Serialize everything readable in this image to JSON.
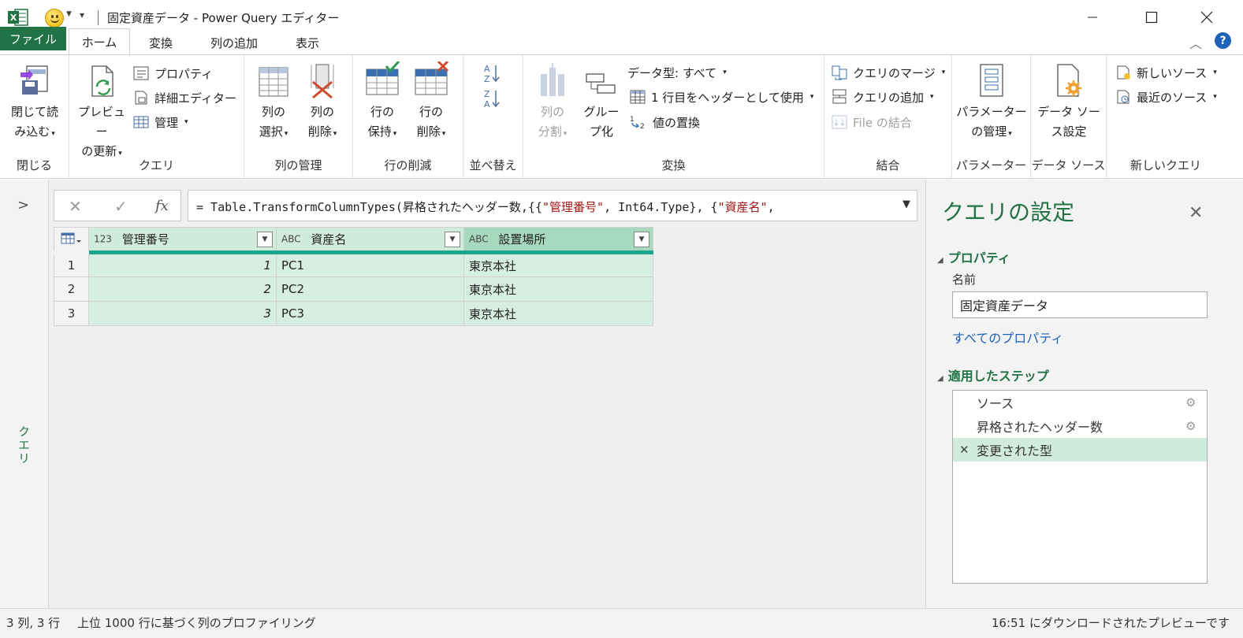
{
  "window": {
    "title": "固定資産データ - Power Query エディター"
  },
  "tabs": [
    "ファイル",
    "ホーム",
    "変換",
    "列の追加",
    "表示"
  ],
  "ribbon": {
    "close": {
      "btn": [
        "閉じて読",
        "み込む"
      ],
      "label": "閉じる"
    },
    "query": {
      "refresh": [
        "プレビュー",
        "の更新"
      ],
      "properties": "プロパティ",
      "advanced": "詳細エディター",
      "manage": "管理",
      "label": "クエリ"
    },
    "columns": {
      "select": [
        "列の",
        "選択"
      ],
      "remove": [
        "列の",
        "削除"
      ],
      "label": "列の管理"
    },
    "rows": {
      "keep": [
        "行の",
        "保持"
      ],
      "remove": [
        "行の",
        "削除"
      ],
      "label": "行の削減"
    },
    "sort": {
      "label": "並べ替え"
    },
    "transform": {
      "split": [
        "列の",
        "分割"
      ],
      "group": [
        "グルー",
        "プ化"
      ],
      "datatype": "データ型: すべて",
      "first_row": "1 行目をヘッダーとして使用",
      "replace": "値の置換",
      "label": "変換"
    },
    "combine": {
      "merge": "クエリのマージ",
      "append": "クエリの追加",
      "files": "File の結合",
      "label": "結合"
    },
    "params": {
      "btn": [
        "パラメーター",
        "の管理"
      ],
      "label": "パラメーター"
    },
    "datasource": {
      "btn": [
        "データ ソー",
        "ス設定"
      ],
      "label": "データ ソース"
    },
    "newquery": {
      "new_source": "新しいソース",
      "recent": "最近のソース",
      "label": "新しいクエリ"
    }
  },
  "left_pane": {
    "label": "クエリ"
  },
  "formula": {
    "prefix": "= Table.TransformColumnTypes(昇格されたヘッダー数,{{",
    "s1": "\"管理番号\"",
    "mid": ", Int64.Type}, {",
    "s2": "\"資産名\"",
    "suffix": ","
  },
  "table": {
    "columns": [
      {
        "type": "123",
        "name": "管理番号"
      },
      {
        "type": "ABC",
        "name": "資産名"
      },
      {
        "type": "ABC",
        "name": "設置場所"
      }
    ],
    "rows": [
      {
        "n": "1",
        "id": "1",
        "name": "PC1",
        "loc": "東京本社"
      },
      {
        "n": "2",
        "id": "2",
        "name": "PC2",
        "loc": "東京本社"
      },
      {
        "n": "3",
        "id": "3",
        "name": "PC3",
        "loc": "東京本社"
      }
    ]
  },
  "settings": {
    "title": "クエリの設定",
    "properties_header": "プロパティ",
    "name_label": "名前",
    "name_value": "固定資産データ",
    "all_props": "すべてのプロパティ",
    "steps_header": "適用したステップ",
    "steps": [
      "ソース",
      "昇格されたヘッダー数",
      "変更された型"
    ]
  },
  "status": {
    "left": "3 列, 3 行",
    "middle": "上位 1000 行に基づく列のプロファイリング",
    "right": "16:51 にダウンロードされたプレビューです"
  },
  "colors": {
    "accent": "#217346",
    "link": "#1e62b6",
    "selection": "#d1ecdd",
    "header_rule": "#1aa58c"
  }
}
